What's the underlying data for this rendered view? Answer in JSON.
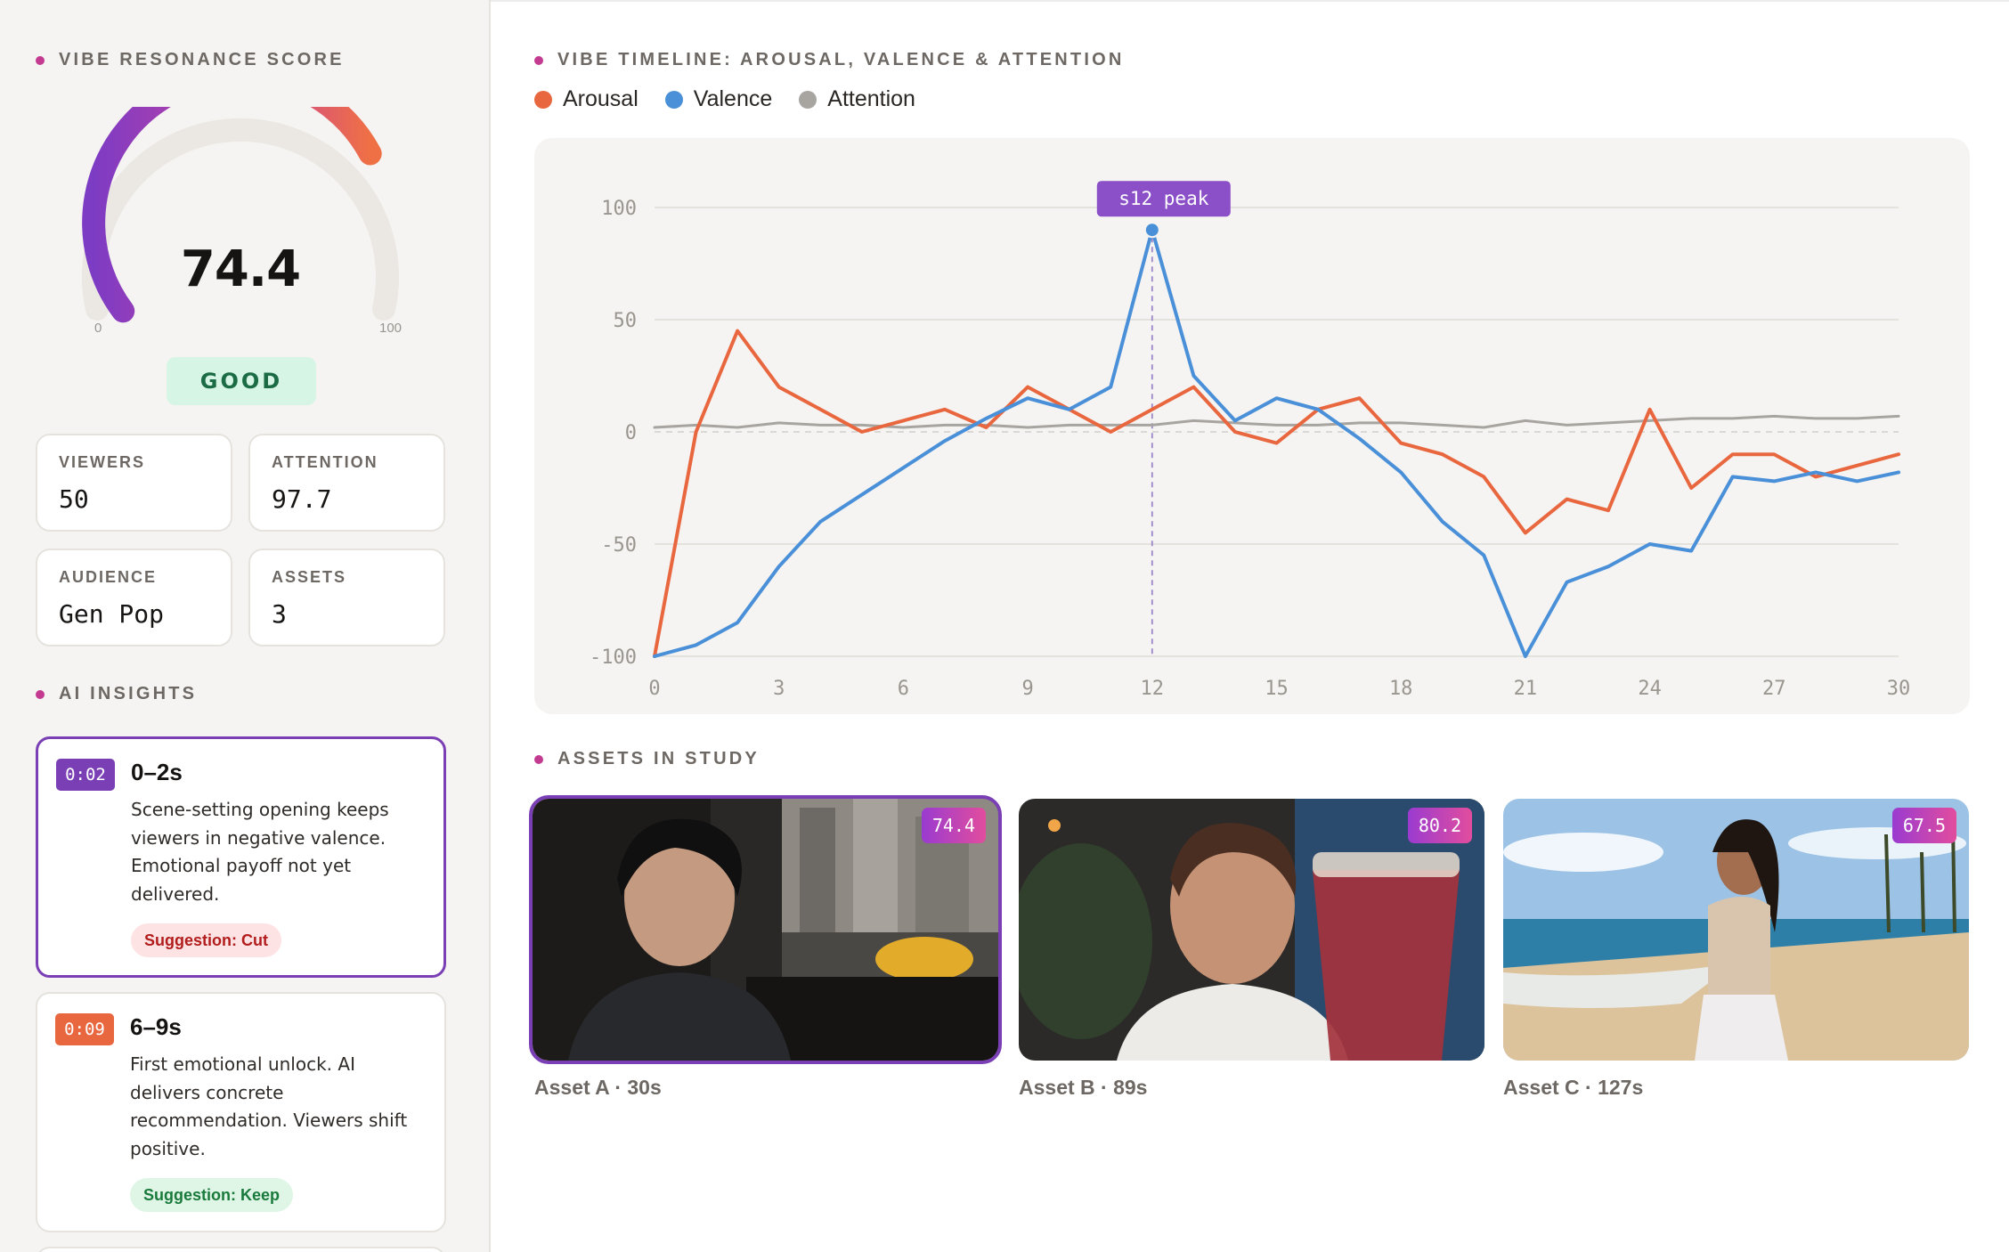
{
  "sidebar": {
    "score_section_title": "VIBE RESONANCE SCORE",
    "gauge": {
      "score": "74.4",
      "value": 74.4,
      "min_label": "0",
      "max_label": "100"
    },
    "rating": "GOOD",
    "stats": [
      {
        "label": "VIEWERS",
        "value": "50"
      },
      {
        "label": "ATTENTION",
        "value": "97.7"
      },
      {
        "label": "AUDIENCE",
        "value": "Gen Pop"
      },
      {
        "label": "ASSETS",
        "value": "3"
      }
    ],
    "insights_title": "AI INSIGHTS",
    "insights": [
      {
        "timestamp": "0:02",
        "title": "0–2s",
        "body": "Scene-setting opening keeps viewers in negative valence. Emotional payoff not yet delivered.",
        "suggestion": "Suggestion: Cut",
        "color": "#7a3fb5"
      },
      {
        "timestamp": "0:09",
        "title": "6–9s",
        "body": "First emotional unlock. AI delivers concrete recommendation. Viewers shift positive.",
        "suggestion": "Suggestion: Keep",
        "color": "#e9673f"
      }
    ]
  },
  "main": {
    "timeline_title": "VIBE TIMELINE: AROUSAL, VALENCE & ATTENTION",
    "assets_title": "ASSETS IN STUDY",
    "assets": [
      {
        "score": "74.4",
        "label": "Asset A · 30s"
      },
      {
        "score": "80.2",
        "label": "Asset B · 89s"
      },
      {
        "score": "67.5",
        "label": "Asset C · 127s"
      }
    ]
  },
  "chart_data": {
    "type": "line",
    "title": "",
    "xlabel": "",
    "ylabel": "",
    "xlim": [
      0,
      30
    ],
    "ylim": [
      -100,
      100
    ],
    "x_ticks": [
      0,
      3,
      6,
      9,
      12,
      15,
      18,
      21,
      24,
      27,
      30
    ],
    "y_ticks": [
      100,
      50,
      0,
      -50,
      -100
    ],
    "grid": true,
    "legend_position": "top-left",
    "x": [
      0,
      1,
      2,
      3,
      4,
      5,
      6,
      7,
      8,
      9,
      10,
      11,
      12,
      13,
      14,
      15,
      16,
      17,
      18,
      19,
      20,
      21,
      22,
      23,
      24,
      25,
      26,
      27,
      28,
      29,
      30
    ],
    "series": [
      {
        "name": "Arousal",
        "color": "#e9673f",
        "values": [
          -100,
          0,
          45,
          20,
          10,
          0,
          5,
          10,
          2,
          20,
          10,
          0,
          10,
          20,
          0,
          -5,
          10,
          15,
          -5,
          -10,
          -20,
          -45,
          -30,
          -35,
          10,
          -25,
          -10,
          -10,
          -20,
          -15,
          -10
        ]
      },
      {
        "name": "Valence",
        "color": "#4a90d9",
        "values": [
          -100,
          -95,
          -85,
          -60,
          -40,
          -28,
          -16,
          -4,
          6,
          15,
          10,
          20,
          90,
          25,
          5,
          15,
          10,
          -3,
          -18,
          -40,
          -55,
          -100,
          -67,
          -60,
          -50,
          -53,
          -20,
          -22,
          -18,
          -22,
          -18
        ]
      },
      {
        "name": "Attention",
        "color": "#a8a5a1",
        "values": [
          2,
          3,
          2,
          4,
          3,
          3,
          2,
          3,
          3,
          2,
          3,
          3,
          3,
          5,
          4,
          3,
          3,
          4,
          4,
          3,
          2,
          5,
          3,
          4,
          5,
          6,
          6,
          7,
          6,
          6,
          7
        ]
      }
    ],
    "annotations": [
      {
        "x": 12,
        "series": "Valence",
        "label": "s12 peak"
      }
    ]
  },
  "colors": {
    "accent_purple": "#7a3fb5",
    "arousal": "#e9673f",
    "valence": "#4a90d9",
    "attention": "#a8a5a1",
    "good_bg": "#d6f5e5",
    "good_text": "#1b6b45"
  }
}
